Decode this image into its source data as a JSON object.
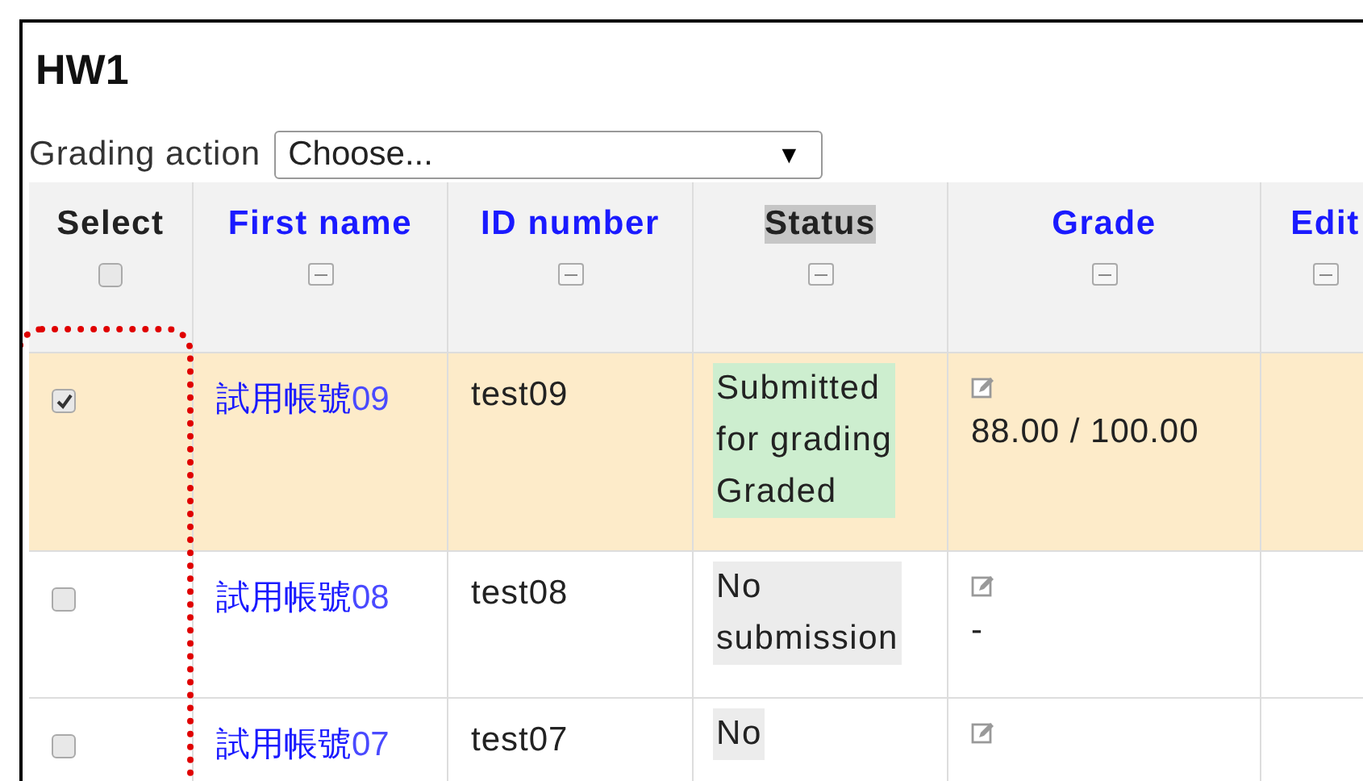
{
  "title": "HW1",
  "grading_action": {
    "label": "Grading action",
    "value": "Choose...",
    "caret": "▼"
  },
  "columns": [
    {
      "label": "Select",
      "kind": "checkbox",
      "link": false,
      "sorted": false,
      "checked": false
    },
    {
      "label": "First name",
      "kind": "text",
      "link": true,
      "sorted": false
    },
    {
      "label": "ID number",
      "kind": "text",
      "link": true,
      "sorted": false
    },
    {
      "label": "Status",
      "kind": "text",
      "link": false,
      "sorted": true
    },
    {
      "label": "Grade",
      "kind": "text",
      "link": true,
      "sorted": false
    },
    {
      "label": "Edit",
      "kind": "text",
      "link": true,
      "sorted": false
    }
  ],
  "rows": [
    {
      "selected": true,
      "checked": true,
      "name": "試用帳號",
      "number": "09",
      "id": "test09",
      "status": {
        "lines": [
          "Submitted",
          "for grading",
          "Graded"
        ],
        "color": "#cdeecf"
      },
      "grade": "88.00 / 100.00"
    },
    {
      "selected": false,
      "checked": false,
      "name": "試用帳號",
      "number": "08",
      "id": "test08",
      "status": {
        "lines": [
          "No",
          "submission"
        ],
        "color": "#ececec"
      },
      "grade": "-"
    },
    {
      "selected": false,
      "checked": false,
      "name": "試用帳號",
      "number": "07",
      "id": "test07",
      "status": {
        "lines": [
          "No"
        ],
        "color": "#ececec"
      }
    }
  ]
}
